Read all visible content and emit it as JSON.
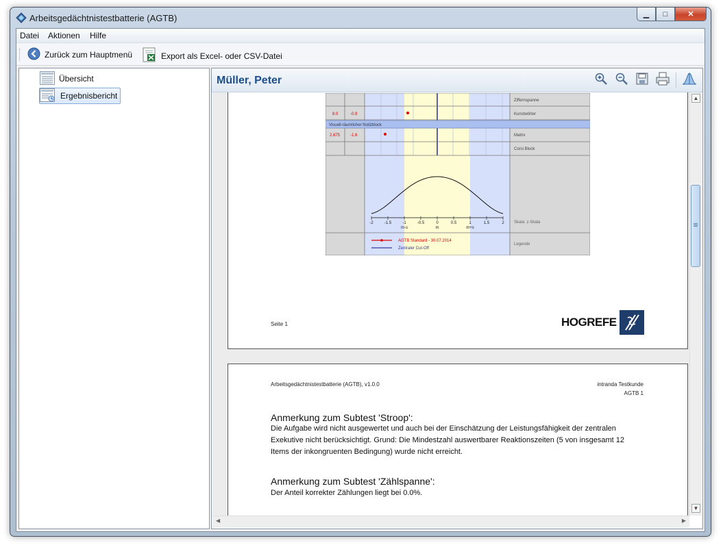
{
  "window": {
    "title": "Arbeitsgedächtnistestbatterie (AGTB)"
  },
  "menu": [
    "Datei",
    "Aktionen",
    "Hilfe"
  ],
  "toolbar": {
    "back_label": "Zurück zum Hauptmenü",
    "export_label": "Export als Excel- oder CSV-Datei"
  },
  "tree": [
    {
      "label": "Übersicht"
    },
    {
      "label": "Ergebnisbericht"
    }
  ],
  "header": {
    "patient": "Müller, Peter"
  },
  "page1": {
    "rows": [
      {
        "col1": "",
        "col2": "",
        "label": "Ziffernspanne"
      },
      {
        "col1": "8.0",
        "col2": "-0.9",
        "label": "Kunstwörter"
      },
      {
        "section": "Visuell-räumlicher Notizblock"
      },
      {
        "col1": "2.875",
        "col2": "-1.6",
        "label": "Matrix"
      },
      {
        "col1": "",
        "col2": "",
        "label": "Corsi Block"
      }
    ],
    "axis_ticks": [
      "-2",
      "-1.5",
      "-1",
      "-0.5",
      "0",
      "0.5",
      "1",
      "1.5",
      "2"
    ],
    "axis_marks": [
      "m-s",
      "m",
      "m+s"
    ],
    "scale_label": "Skala: z-Skala",
    "legend": {
      "label": "Legende",
      "series": "AGTB Standard - 30.07.2014",
      "cutoff": "Zentraler Cut-Off"
    },
    "footer": "Seite 1",
    "logo": "HOGREFE"
  },
  "page2": {
    "header_left": "Arbeitsgedächtnistestbatterie (AGTB), v1.0.0",
    "header_right1": "intranda Testkunde",
    "header_right2": "AGTB 1",
    "section1_title": "Anmerkung zum Subtest 'Stroop':",
    "section1_line1": "Die Aufgabe wird nicht ausgewertet und auch bei der Einschätzung der Leistungsfähigkeit der zentralen",
    "section1_line2": "Exekutive nicht berücksichtigt. Grund: Die Mindestzahl auswertbarer Reaktionszeiten (5 von insgesamt 12",
    "section1_line3": "Items der inkongruenten Bedingung) wurde nicht erreicht.",
    "section2_title": "Anmerkung zum Subtest 'Zählspanne':",
    "section2_line1": "Der Anteil korrekter Zählungen liegt bei 0.0%."
  },
  "colors": {
    "accent": "#1d4f8a",
    "series": "#e00000",
    "cutoff": "#3a3aa0",
    "band_blue": "#d6e0fb",
    "band_yellow": "#fdfcd2"
  }
}
